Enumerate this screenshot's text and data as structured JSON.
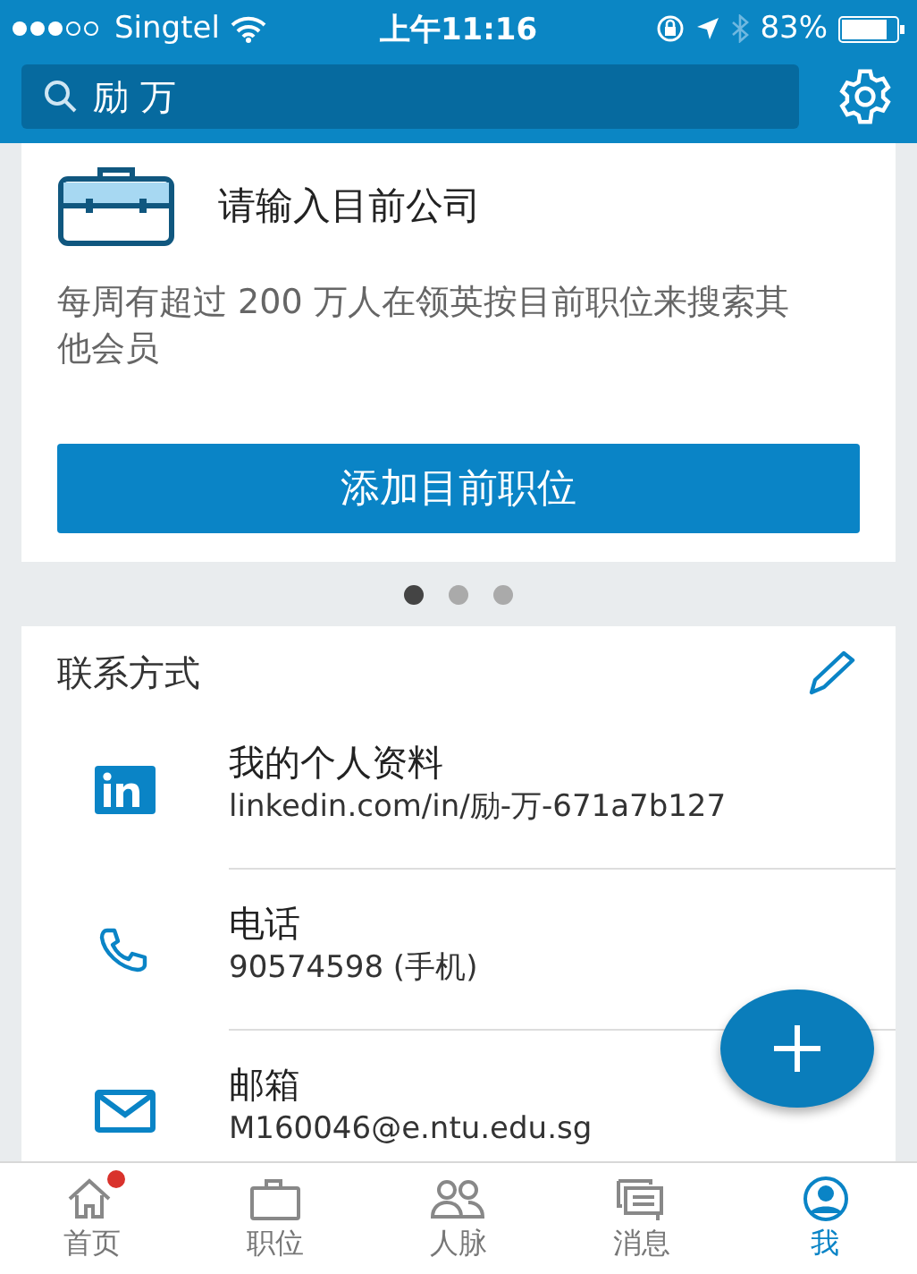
{
  "status_bar": {
    "carrier": "Singtel",
    "time": "上午11:16",
    "battery": "83%"
  },
  "search": {
    "value": "励 万"
  },
  "position_card": {
    "title": "请输入目前公司",
    "description": "每周有超过 200 万人在领英按目前职位来搜索其他会员",
    "button": "添加目前职位"
  },
  "pager": [
    {
      "selected": true
    },
    {
      "selected": false
    },
    {
      "selected": false
    }
  ],
  "contact": {
    "title": "联系方式",
    "items": [
      {
        "kind": "linkedin",
        "label": "我的个人资料",
        "value": "linkedin.com/in/励-万-671a7b127"
      },
      {
        "kind": "phone",
        "label": "电话",
        "value": "90574598 (手机)"
      },
      {
        "kind": "email",
        "label": "邮箱",
        "value": "M160046@e.ntu.edu.sg"
      }
    ]
  },
  "tabs": [
    {
      "kind": "home",
      "label": "首页",
      "selected": false,
      "badge": true
    },
    {
      "kind": "jobs",
      "label": "职位",
      "selected": false,
      "badge": false
    },
    {
      "kind": "network",
      "label": "人脉",
      "selected": false,
      "badge": false
    },
    {
      "kind": "messages",
      "label": "消息",
      "selected": false,
      "badge": false
    },
    {
      "kind": "me",
      "label": "我",
      "selected": true,
      "badge": false
    }
  ]
}
